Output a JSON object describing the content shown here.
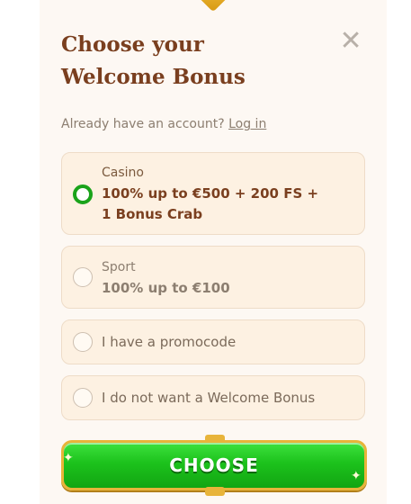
{
  "modal": {
    "title": "Choose your Welcome Bonus",
    "login_prompt": "Already have an account?",
    "login_link": "Log in"
  },
  "options": [
    {
      "category": "Casino",
      "offer": "100% up to €500 + 200 FS +\n1 Bonus Crab",
      "selected": true
    },
    {
      "category": "Sport",
      "offer": "100% up to €100",
      "selected": false
    },
    {
      "label": "I have a promocode",
      "selected": false
    },
    {
      "label": "I do not want a Welcome Bonus",
      "selected": false
    }
  ],
  "cta": {
    "label": "CHOOSE"
  },
  "colors": {
    "title": "#7a3f1f",
    "accent_green": "#1aa31a",
    "button_gold": "#e8b43a",
    "option_bg": "#fdf1e2"
  },
  "icons": {
    "close": "close-icon",
    "radio_selected": "radio-checked-icon",
    "radio_unselected": "radio-unchecked-icon"
  }
}
